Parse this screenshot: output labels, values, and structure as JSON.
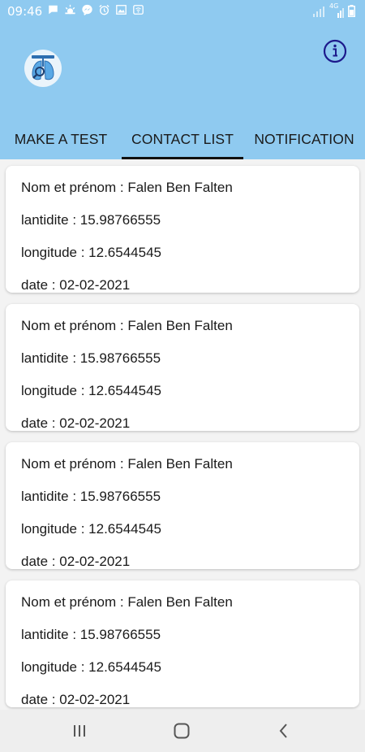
{
  "status_bar": {
    "time": "09:46",
    "network": "4G",
    "notification_icons": [
      "chat-bubble-icon",
      "weather-icon",
      "messenger-icon",
      "alarm-icon",
      "image-icon",
      "wifi-calling-icon"
    ],
    "system_icons": [
      "signal-icon",
      "4g-signal-icon",
      "battery-icon"
    ]
  },
  "header": {
    "background_color": "#8fcaf0",
    "logo_icon": "lungs-logo-icon",
    "info_icon": "info-icon"
  },
  "tabs": [
    {
      "label": "MAKE A TEST",
      "active": false
    },
    {
      "label": "CONTACT LIST",
      "active": true
    },
    {
      "label": "NOTIFICATION",
      "active": false
    }
  ],
  "contacts": [
    {
      "name_line": "Nom et prénom : Falen Ben Falten",
      "latitude_line": "lantidite : 15.98766555",
      "longitude_line": "longitude : 12.6544545",
      "date_line": "date : 02-02-2021"
    },
    {
      "name_line": "Nom et prénom : Falen Ben Falten",
      "latitude_line": "lantidite : 15.98766555",
      "longitude_line": "longitude : 12.6544545",
      "date_line": "date : 02-02-2021"
    },
    {
      "name_line": "Nom et prénom : Falen Ben Falten",
      "latitude_line": "lantidite : 15.98766555",
      "longitude_line": "longitude : 12.6544545",
      "date_line": "date : 02-02-2021"
    },
    {
      "name_line": "Nom et prénom : Falen Ben Falten",
      "latitude_line": "lantidite : 15.98766555",
      "longitude_line": "longitude : 12.6544545",
      "date_line": "date : 02-02-2021"
    }
  ],
  "nav_bar": {
    "buttons": [
      "recent-apps-icon",
      "home-icon",
      "back-icon"
    ]
  }
}
